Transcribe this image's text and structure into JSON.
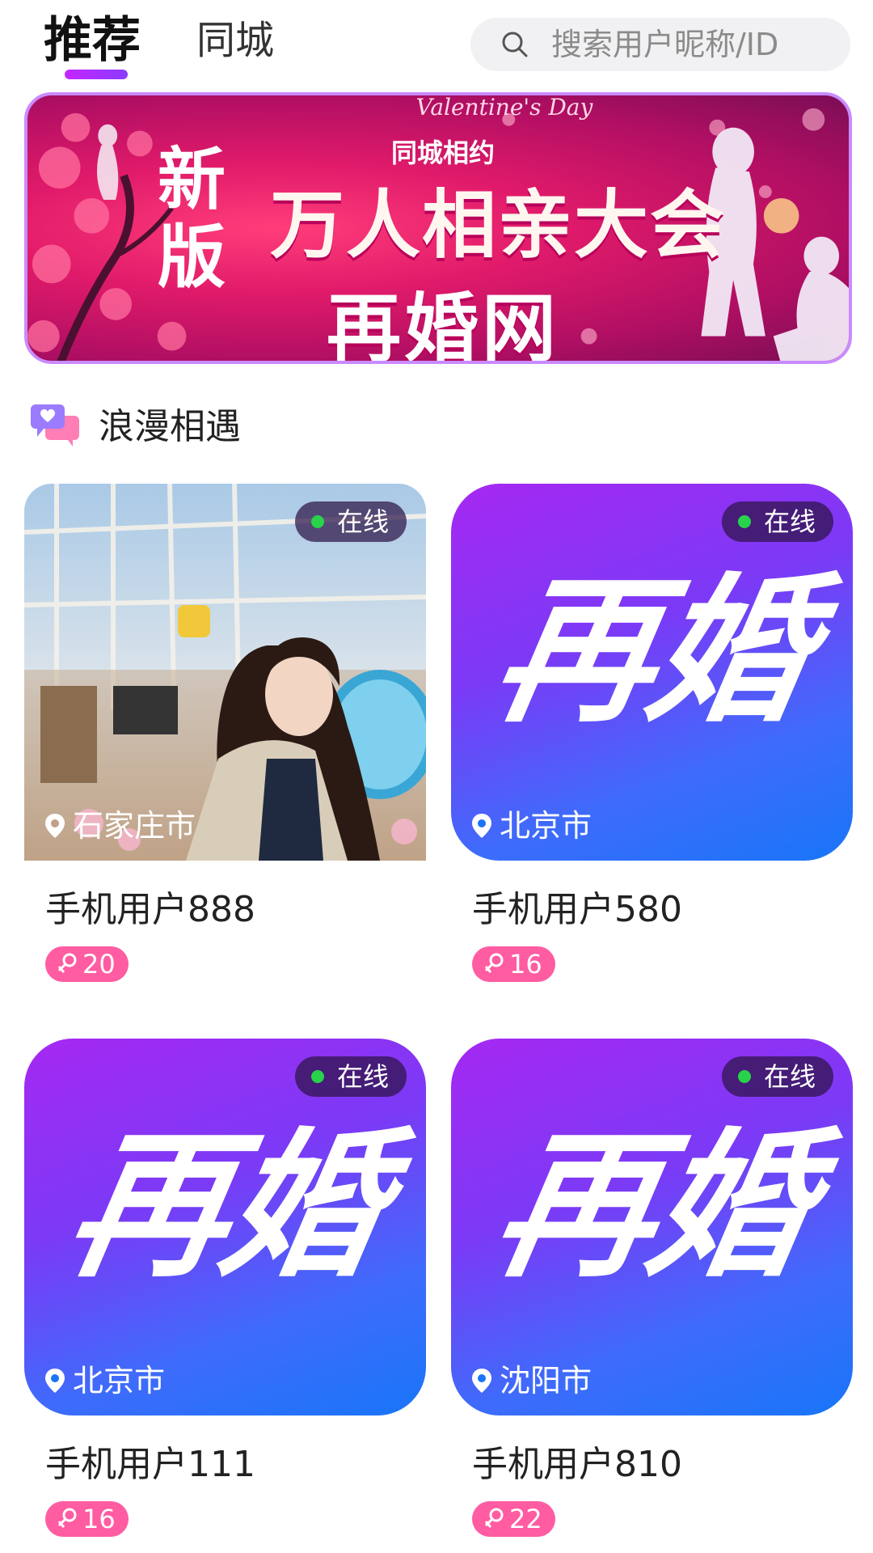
{
  "header": {
    "tabs": [
      {
        "label": "推荐",
        "active": true
      },
      {
        "label": "同城",
        "active": false
      }
    ],
    "search": {
      "placeholder": "搜索用户昵称/ID",
      "icon": "search-icon"
    }
  },
  "banner": {
    "en_text": "Valentine's Day",
    "sub_text": "同城相约",
    "new_text": "新版",
    "title": "万人相亲大会",
    "subtitle": "再婚网"
  },
  "section": {
    "title": "浪漫相遇",
    "icon": "chat-bubbles-icon"
  },
  "cards": [
    {
      "name": "手机用户888",
      "age": "20",
      "location": "石家庄市",
      "status": "在线",
      "avatar": "photo"
    },
    {
      "name": "手机用户580",
      "age": "16",
      "location": "北京市",
      "status": "在线",
      "avatar": "logo"
    },
    {
      "name": "手机用户111",
      "age": "16",
      "location": "北京市",
      "status": "在线",
      "avatar": "logo"
    },
    {
      "name": "手机用户810",
      "age": "22",
      "location": "沈阳市",
      "status": "在线",
      "avatar": "logo"
    }
  ],
  "logo_text": "再婚",
  "colors": {
    "accent": "#a628f2",
    "online_dot": "#28d24a",
    "badge": "#ff5ca2",
    "logo_gradient_start": "#a628f2",
    "logo_gradient_end": "#1875f8"
  }
}
